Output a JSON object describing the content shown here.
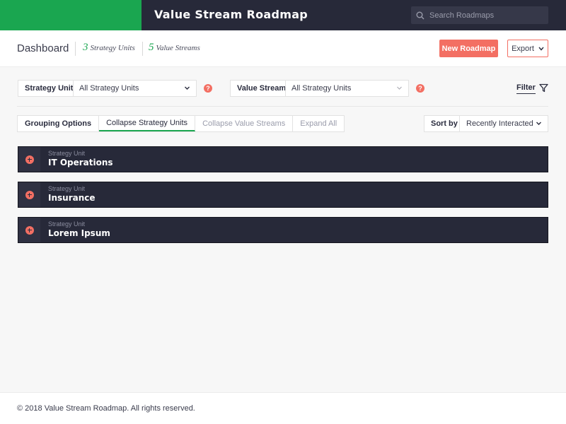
{
  "topbar": {
    "app_title": "Value Stream Roadmap",
    "search_placeholder": "Search Roadmaps",
    "brand_color": "#1aa650"
  },
  "header": {
    "title": "Dashboard",
    "strategy_units_count": "3",
    "strategy_units_label": "Strategy Units",
    "value_streams_count": "5",
    "value_streams_label": "Value Streams",
    "new_button": "New Roadmap",
    "export_button": "Export"
  },
  "filters": {
    "strategy_unit_label": "Strategy Unit",
    "strategy_unit_value": "All Strategy Units",
    "value_stream_label": "Value Stream",
    "value_stream_value": "All Strategy Units",
    "help_glyph": "?",
    "filter_label": "Filter"
  },
  "grouping": {
    "label": "Grouping Options",
    "options": [
      "Collapse Strategy Units",
      "Collapse Value Streams",
      "Expand All"
    ],
    "active": "Collapse Strategy Units"
  },
  "sort": {
    "label": "Sort by",
    "value": "Recently Interacted"
  },
  "units": [
    {
      "kind": "Strategy Unit",
      "name": "IT Operations"
    },
    {
      "kind": "Strategy Unit",
      "name": "Insurance"
    },
    {
      "kind": "Strategy Unit",
      "name": "Lorem Ipsum"
    }
  ],
  "footer": {
    "text": "© 2018 Value Stream Roadmap. All rights reserved."
  },
  "colors": {
    "accent": "#f36f63",
    "dark": "#272939",
    "green": "#1aa650"
  }
}
